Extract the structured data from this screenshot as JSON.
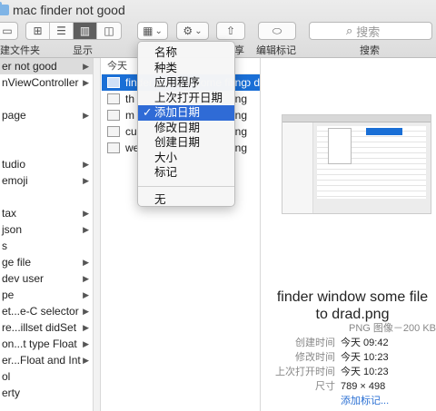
{
  "window": {
    "title": "mac finder not good"
  },
  "toolbar": {
    "new_folder_label": "建文件夹",
    "view_label": "显示",
    "share_label": "享",
    "tag_label": "编辑标记",
    "search_label": "搜索",
    "search_placeholder": "搜索",
    "view_icon_glyph": "▦",
    "arrange_chevron": "⌄",
    "gear_glyph": "⚙",
    "share_glyph": "⇧",
    "tag_glyph": "⬭",
    "search_glyph": "⌕"
  },
  "column1": {
    "rows": [
      "er not good",
      "nViewController",
      "",
      "page",
      "",
      "",
      "tudio",
      "emoji",
      "",
      "tax",
      " json",
      "s",
      "ge file",
      " dev user",
      "pe",
      "et...e-C selector",
      "re...illset didSet",
      "on...t type Float",
      "er...Float and Int",
      "ol",
      "erty"
    ],
    "arrow_glyph": "▶"
  },
  "column2": {
    "header": "今天",
    "files": [
      "finder window some file to drad.png",
      "th",
      "m",
      "cu",
      "we"
    ],
    "file_tails": [
      "ng",
      "ng",
      "ng",
      "ng",
      "ng"
    ]
  },
  "menu": {
    "items": [
      "名称",
      "种类",
      "应用程序",
      "上次打开日期",
      "添加日期",
      "修改日期",
      "创建日期",
      "大小",
      "标记"
    ],
    "checked_index": 4,
    "check_glyph": "✓",
    "none_label": "无"
  },
  "preview": {
    "title_line1": "finder window some file",
    "title_line2": "to drad.png",
    "kind": "PNG 图像－200 KB",
    "info": [
      {
        "key": "创建时间",
        "value": "今天 09:42"
      },
      {
        "key": "修改时间",
        "value": "今天 10:23"
      },
      {
        "key": "上次打开时间",
        "value": "今天 10:23"
      },
      {
        "key": "尺寸",
        "value": "789 × 498"
      }
    ],
    "add_tags": "添加标记..."
  },
  "colors": {
    "selection": "#1a6fd6",
    "menu_highlight": "#2f6bd6"
  }
}
